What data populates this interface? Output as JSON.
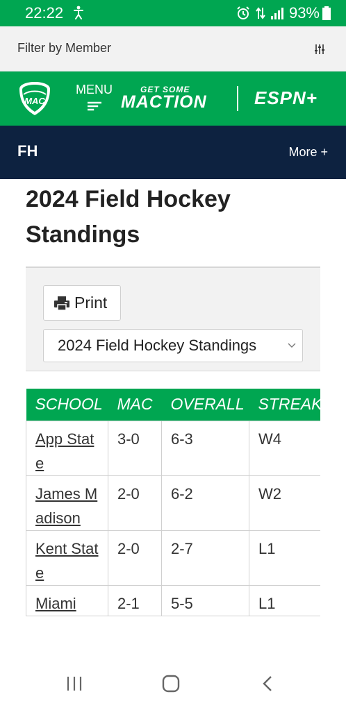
{
  "status_bar": {
    "time": "22:22",
    "battery": "93%"
  },
  "filter_bar": {
    "label": "Filter by Member"
  },
  "header": {
    "logo_text": "MAC",
    "menu_label": "MENU",
    "tagline_small": "GET SOME",
    "tagline_big": "MACTION",
    "espn": "ESPN+"
  },
  "sport_bar": {
    "code": "FH",
    "more_label": "More +"
  },
  "page": {
    "title": "2024 Field Hockey Standings"
  },
  "tools": {
    "print_label": "Print",
    "select_value": "2024 Field Hockey Standings"
  },
  "standings": {
    "columns": [
      "SCHOOL",
      "MAC",
      "OVERALL",
      "STREAK"
    ],
    "rows": [
      {
        "school": "App State",
        "mac": "3-0",
        "overall": "6-3",
        "streak": "W4"
      },
      {
        "school": "James Madison",
        "mac": "2-0",
        "overall": "6-2",
        "streak": "W2"
      },
      {
        "school": "Kent State",
        "mac": "2-0",
        "overall": "2-7",
        "streak": "L1"
      },
      {
        "school": "Miami",
        "mac": "2-1",
        "overall": "5-5",
        "streak": "L1"
      }
    ]
  },
  "colors": {
    "mac_green": "#00a651",
    "navy": "#0d2240"
  }
}
